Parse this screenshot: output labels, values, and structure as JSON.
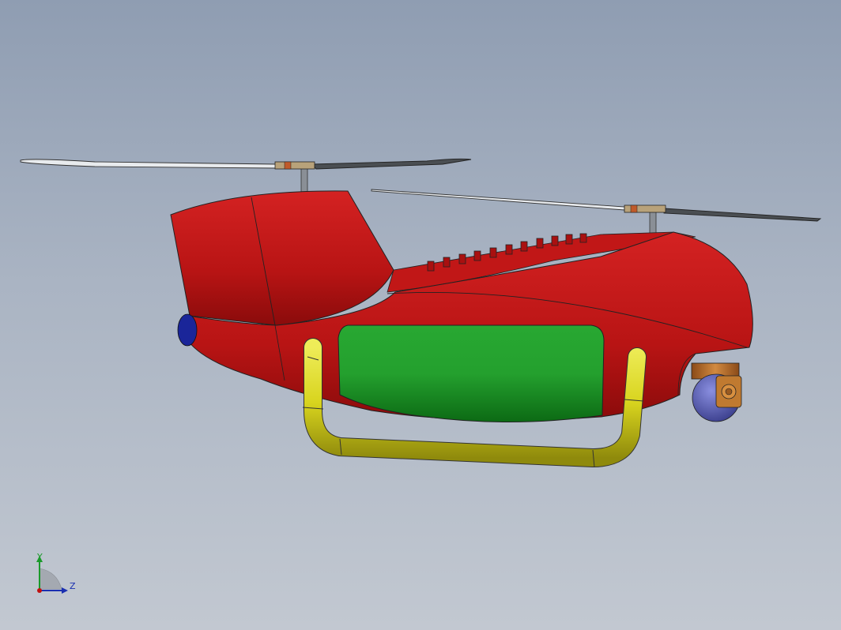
{
  "viewport": {
    "background_top": "#8f9db2",
    "background_bottom": "#c2c8d1"
  },
  "model": {
    "body_color": "#c51818",
    "body_dark": "#8e0d0d",
    "panel_color": "#1f9a2a",
    "skid_color": "#d5d21c",
    "nose_cap_color": "#1a2599",
    "gimbal_ball_color": "#5a5fb8",
    "gimbal_mount_color": "#b86a2a",
    "rotor_mast_color": "#8a8f96",
    "blade_color": "#4a4e52"
  },
  "triad": {
    "y_label": "Y",
    "z_label": "Z",
    "y_color": "#1a9a2a",
    "z_color": "#1a2fb0",
    "origin_color": "#c01010"
  }
}
